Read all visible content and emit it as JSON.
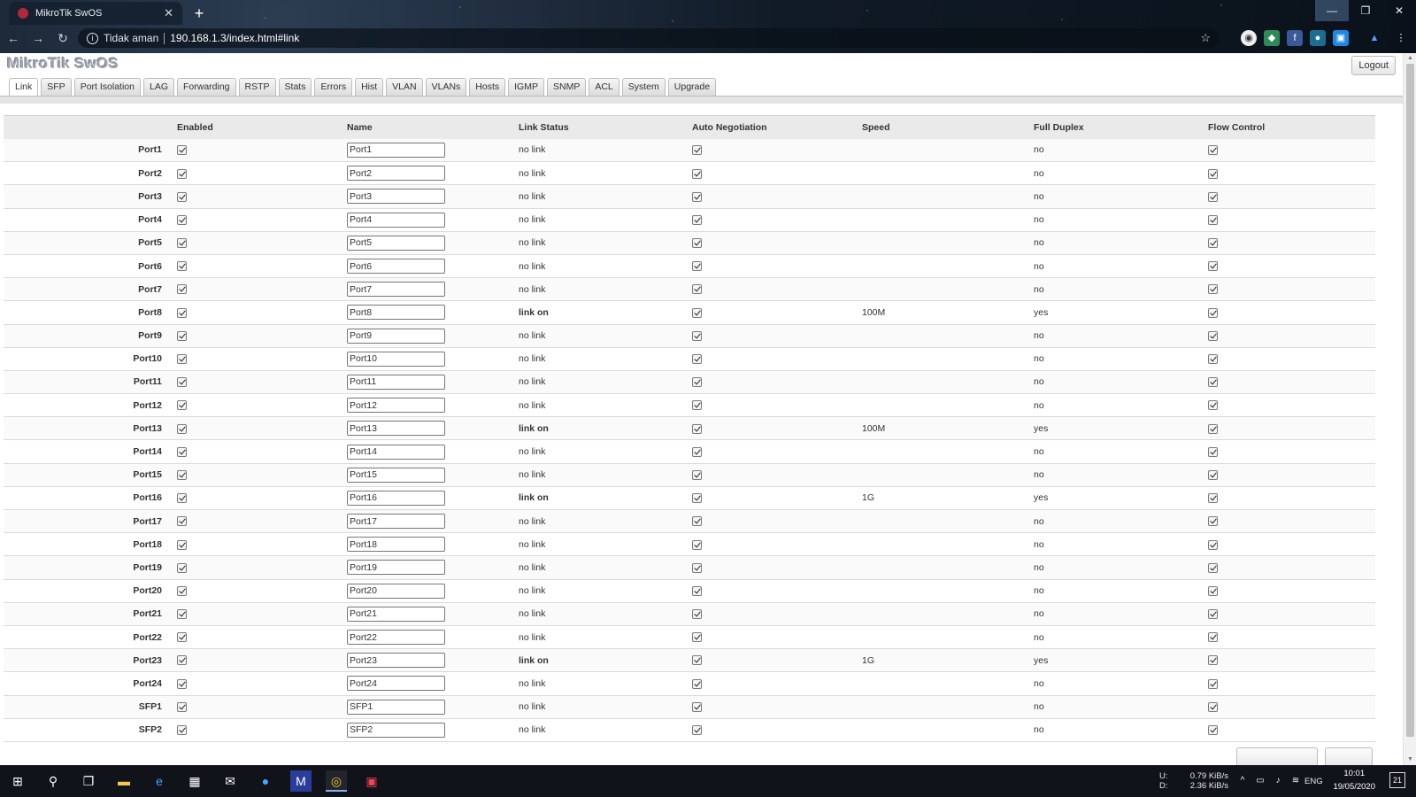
{
  "browser": {
    "tab_title": "MikroTik SwOS",
    "security_label": "Tidak aman",
    "url": "190.168.1.3/index.html#link"
  },
  "app": {
    "brand": "MikroTik SwOS",
    "logout_label": "Logout",
    "tabs": [
      "Link",
      "SFP",
      "Port Isolation",
      "LAG",
      "Forwarding",
      "RSTP",
      "Stats",
      "Errors",
      "Hist",
      "VLAN",
      "VLANs",
      "Hosts",
      "IGMP",
      "SNMP",
      "ACL",
      "System",
      "Upgrade"
    ],
    "active_tab": "Link"
  },
  "table": {
    "headers": {
      "enabled": "Enabled",
      "name": "Name",
      "link_status": "Link Status",
      "auto_negotiation": "Auto Negotiation",
      "speed": "Speed",
      "full_duplex": "Full Duplex",
      "flow_control": "Flow Control"
    },
    "rows": [
      {
        "port": "Port1",
        "name": "Port1",
        "status": "no link",
        "speed": "",
        "duplex": "no"
      },
      {
        "port": "Port2",
        "name": "Port2",
        "status": "no link",
        "speed": "",
        "duplex": "no"
      },
      {
        "port": "Port3",
        "name": "Port3",
        "status": "no link",
        "speed": "",
        "duplex": "no"
      },
      {
        "port": "Port4",
        "name": "Port4",
        "status": "no link",
        "speed": "",
        "duplex": "no"
      },
      {
        "port": "Port5",
        "name": "Port5",
        "status": "no link",
        "speed": "",
        "duplex": "no"
      },
      {
        "port": "Port6",
        "name": "Port6",
        "status": "no link",
        "speed": "",
        "duplex": "no"
      },
      {
        "port": "Port7",
        "name": "Port7",
        "status": "no link",
        "speed": "",
        "duplex": "no"
      },
      {
        "port": "Port8",
        "name": "Port8",
        "status": "link on",
        "speed": "100M",
        "duplex": "yes"
      },
      {
        "port": "Port9",
        "name": "Port9",
        "status": "no link",
        "speed": "",
        "duplex": "no"
      },
      {
        "port": "Port10",
        "name": "Port10",
        "status": "no link",
        "speed": "",
        "duplex": "no"
      },
      {
        "port": "Port11",
        "name": "Port11",
        "status": "no link",
        "speed": "",
        "duplex": "no"
      },
      {
        "port": "Port12",
        "name": "Port12",
        "status": "no link",
        "speed": "",
        "duplex": "no"
      },
      {
        "port": "Port13",
        "name": "Port13",
        "status": "link on",
        "speed": "100M",
        "duplex": "yes"
      },
      {
        "port": "Port14",
        "name": "Port14",
        "status": "no link",
        "speed": "",
        "duplex": "no"
      },
      {
        "port": "Port15",
        "name": "Port15",
        "status": "no link",
        "speed": "",
        "duplex": "no"
      },
      {
        "port": "Port16",
        "name": "Port16",
        "status": "link on",
        "speed": "1G",
        "duplex": "yes"
      },
      {
        "port": "Port17",
        "name": "Port17",
        "status": "no link",
        "speed": "",
        "duplex": "no"
      },
      {
        "port": "Port18",
        "name": "Port18",
        "status": "no link",
        "speed": "",
        "duplex": "no"
      },
      {
        "port": "Port19",
        "name": "Port19",
        "status": "no link",
        "speed": "",
        "duplex": "no"
      },
      {
        "port": "Port20",
        "name": "Port20",
        "status": "no link",
        "speed": "",
        "duplex": "no"
      },
      {
        "port": "Port21",
        "name": "Port21",
        "status": "no link",
        "speed": "",
        "duplex": "no"
      },
      {
        "port": "Port22",
        "name": "Port22",
        "status": "no link",
        "speed": "",
        "duplex": "no"
      },
      {
        "port": "Port23",
        "name": "Port23",
        "status": "link on",
        "speed": "1G",
        "duplex": "yes"
      },
      {
        "port": "Port24",
        "name": "Port24",
        "status": "no link",
        "speed": "",
        "duplex": "no"
      },
      {
        "port": "SFP1",
        "name": "SFP1",
        "status": "no link",
        "speed": "",
        "duplex": "no"
      },
      {
        "port": "SFP2",
        "name": "SFP2",
        "status": "no link",
        "speed": "",
        "duplex": "no"
      }
    ]
  },
  "taskbar": {
    "net_up": "0.79 KiB/s",
    "net_down": "2.36 KiB/s",
    "net_up_label": "U:",
    "net_down_label": "D:",
    "language": "ENG",
    "time": "10:01",
    "date": "19/05/2020",
    "notifications": "21"
  }
}
